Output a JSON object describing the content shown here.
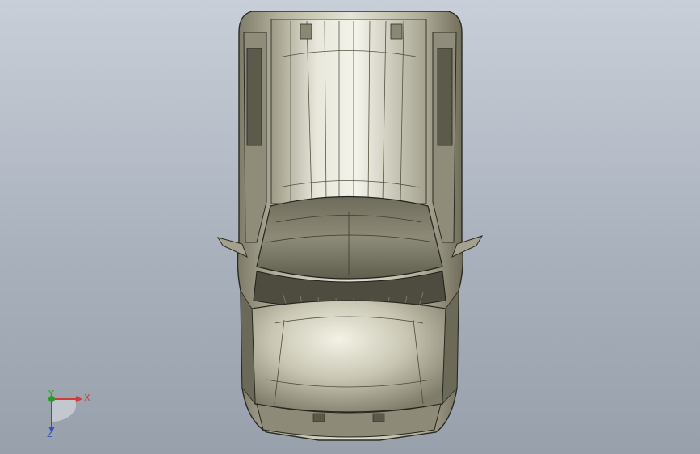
{
  "viewport": {
    "background_top": "#c9cfd8",
    "background_bottom": "#98a0ac",
    "model": "pickup-truck-top-view"
  },
  "triad": {
    "x_label": "X",
    "y_label": "Y",
    "z_label": "Z",
    "x_color": "#d43a3a",
    "y_color": "#2a9a2a",
    "z_color": "#3a4fbf"
  }
}
